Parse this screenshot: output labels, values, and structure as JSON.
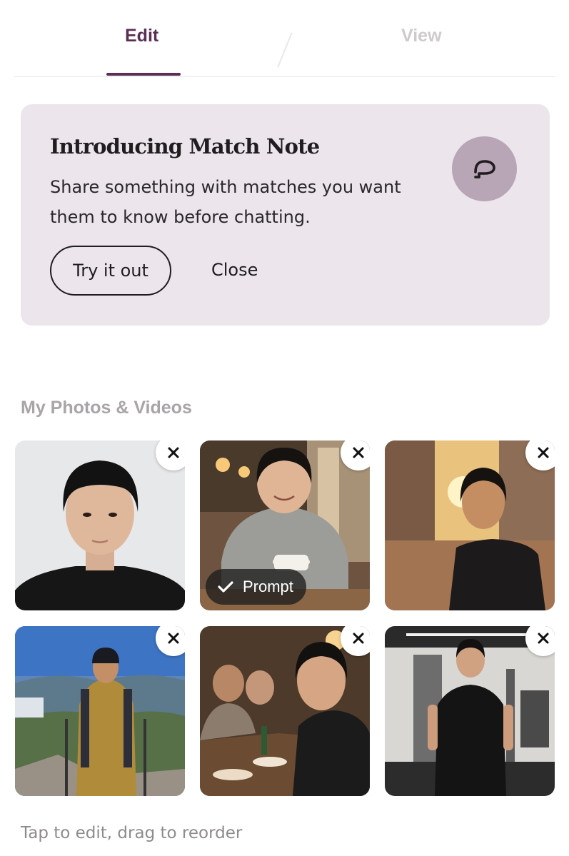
{
  "tabs": {
    "edit_label": "Edit",
    "view_label": "View",
    "active": "Edit"
  },
  "banner": {
    "title": "Introducing Match Note",
    "body": "Share something with matches you want them to know before chatting.",
    "icon": "chat-bubble-icon",
    "try_label": "Try it out",
    "close_label": "Close"
  },
  "photos": {
    "section_title": "My Photos & Videos",
    "remove_icon": "close-icon",
    "prompt_label": "Prompt",
    "items": [
      {
        "scene": "portrait on grey background",
        "has_prompt": false
      },
      {
        "scene": "cafe with coffee cup",
        "has_prompt": true
      },
      {
        "scene": "city street at sunset",
        "has_prompt": false
      },
      {
        "scene": "mountain hiking",
        "has_prompt": false
      },
      {
        "scene": "restaurant dinner",
        "has_prompt": false
      },
      {
        "scene": "gym",
        "has_prompt": false
      }
    ],
    "hint": "Tap to edit, drag to reorder"
  },
  "colors": {
    "accent": "#5b2f55",
    "banner_bg": "#ece6ec",
    "icon_bg": "#b8a5b6"
  }
}
